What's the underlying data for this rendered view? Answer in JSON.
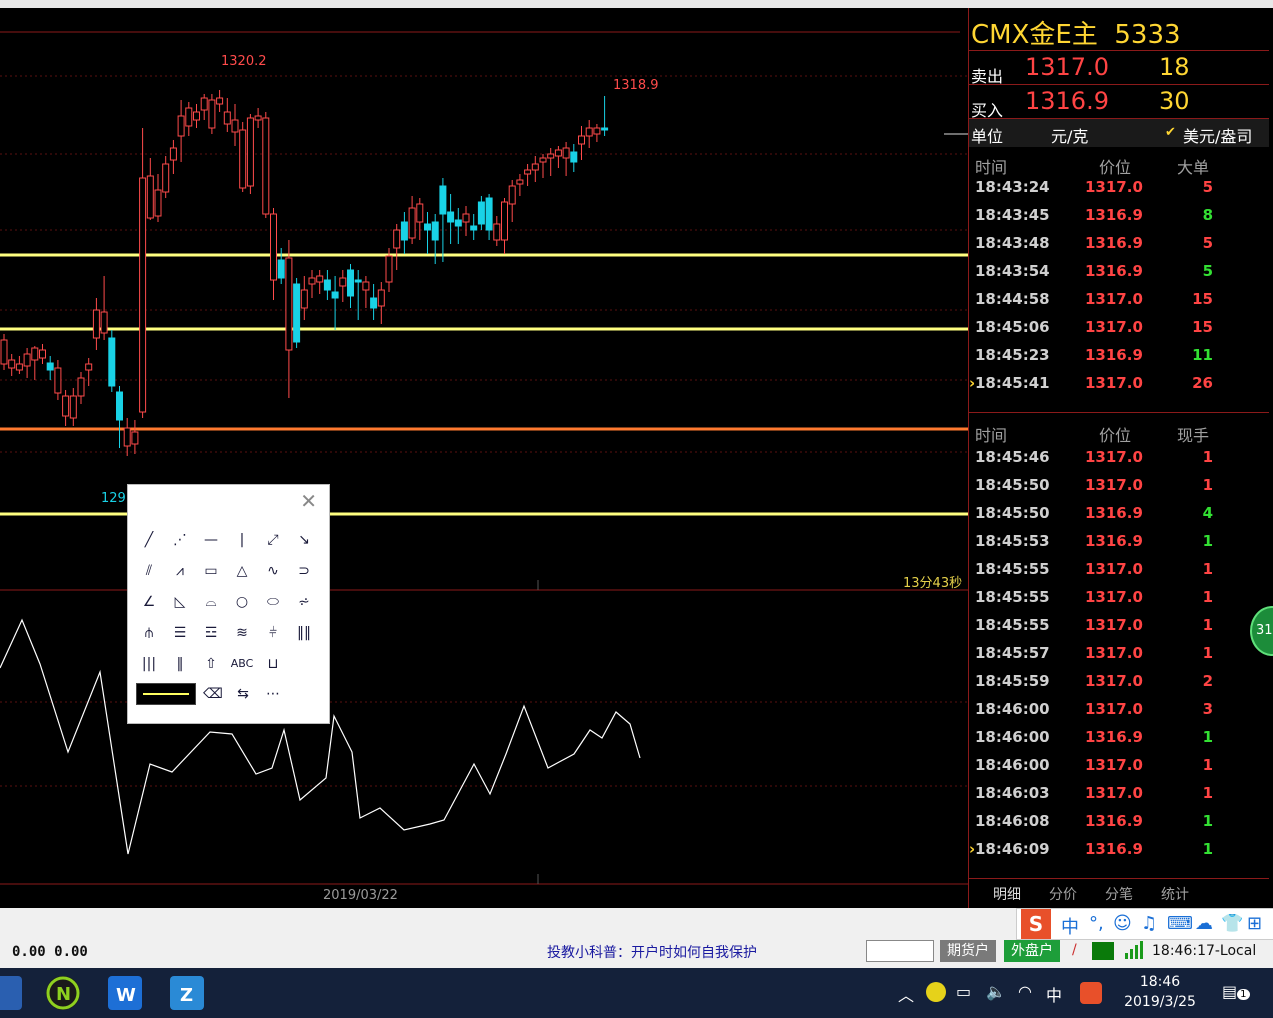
{
  "chart": {
    "high_label": "1320.2",
    "last_high_label": "1318.9",
    "low_label": "129",
    "countdown": "13分43秒",
    "date": "2019/03/22"
  },
  "quote": {
    "symbol": "CMX金E主",
    "code": "5333",
    "ask_label": "卖出",
    "ask_price": "1317.0",
    "ask_vol": "18",
    "bid_label": "买入",
    "bid_price": "1316.9",
    "bid_vol": "30",
    "unit_label": "单位",
    "unit_a": "元/克",
    "unit_check": "✔",
    "unit_b": "美元/盎司"
  },
  "big_trades": {
    "headers": [
      "时间",
      "价位",
      "大单"
    ],
    "rows": [
      {
        "time": "18:43:24",
        "price": "1317.0",
        "vol": "5",
        "dir": "up"
      },
      {
        "time": "18:43:45",
        "price": "1316.9",
        "vol": "8",
        "dir": "down"
      },
      {
        "time": "18:43:48",
        "price": "1316.9",
        "vol": "5",
        "dir": "up"
      },
      {
        "time": "18:43:54",
        "price": "1316.9",
        "vol": "5",
        "dir": "down"
      },
      {
        "time": "18:44:58",
        "price": "1317.0",
        "vol": "15",
        "dir": "up"
      },
      {
        "time": "18:45:06",
        "price": "1317.0",
        "vol": "15",
        "dir": "up"
      },
      {
        "time": "18:45:23",
        "price": "1316.9",
        "vol": "11",
        "dir": "down"
      },
      {
        "time": "18:45:41",
        "price": "1317.0",
        "vol": "26",
        "dir": "up",
        "marker": "›"
      }
    ]
  },
  "ticks": {
    "headers": [
      "时间",
      "价位",
      "现手"
    ],
    "rows": [
      {
        "time": "18:45:46",
        "price": "1317.0",
        "vol": "1",
        "dir": "up"
      },
      {
        "time": "18:45:50",
        "price": "1317.0",
        "vol": "1",
        "dir": "up"
      },
      {
        "time": "18:45:50",
        "price": "1316.9",
        "vol": "4",
        "dir": "down"
      },
      {
        "time": "18:45:53",
        "price": "1316.9",
        "vol": "1",
        "dir": "down"
      },
      {
        "time": "18:45:55",
        "price": "1317.0",
        "vol": "1",
        "dir": "up"
      },
      {
        "time": "18:45:55",
        "price": "1317.0",
        "vol": "1",
        "dir": "up"
      },
      {
        "time": "18:45:55",
        "price": "1317.0",
        "vol": "1",
        "dir": "up"
      },
      {
        "time": "18:45:57",
        "price": "1317.0",
        "vol": "1",
        "dir": "up"
      },
      {
        "time": "18:45:59",
        "price": "1317.0",
        "vol": "2",
        "dir": "up"
      },
      {
        "time": "18:46:00",
        "price": "1317.0",
        "vol": "3",
        "dir": "up"
      },
      {
        "time": "18:46:00",
        "price": "1316.9",
        "vol": "1",
        "dir": "down"
      },
      {
        "time": "18:46:00",
        "price": "1317.0",
        "vol": "1",
        "dir": "up"
      },
      {
        "time": "18:46:03",
        "price": "1317.0",
        "vol": "1",
        "dir": "up"
      },
      {
        "time": "18:46:08",
        "price": "1316.9",
        "vol": "1",
        "dir": "down"
      },
      {
        "time": "18:46:09",
        "price": "1316.9",
        "vol": "1",
        "dir": "down",
        "marker": "›"
      }
    ]
  },
  "tabs": [
    "明细",
    "分价",
    "分笔",
    "统计"
  ],
  "status": {
    "left_values": "0.00  0.00",
    "ticker": "投教小科普：开户时如何自我保护",
    "btn_futures": "期货户",
    "btn_foreign": "外盘户",
    "clock": "18:46:17-Local"
  },
  "ime": {
    "logo": "S",
    "items": [
      "中",
      "°,",
      "☺",
      "♫",
      "⌨",
      "☁",
      "👕",
      "⊞"
    ]
  },
  "side_badge": "31",
  "taskbar": {
    "time": "18:46",
    "date": "2019/3/25",
    "lang": "中",
    "notif": "1"
  },
  "colors": {
    "up": "#ff4444",
    "down": "#33e033",
    "candle_up": "#ff4b4b",
    "candle_down": "#19d2e6",
    "hline_yellow": "#ffff80",
    "hline_orange": "#ff7a30"
  }
}
